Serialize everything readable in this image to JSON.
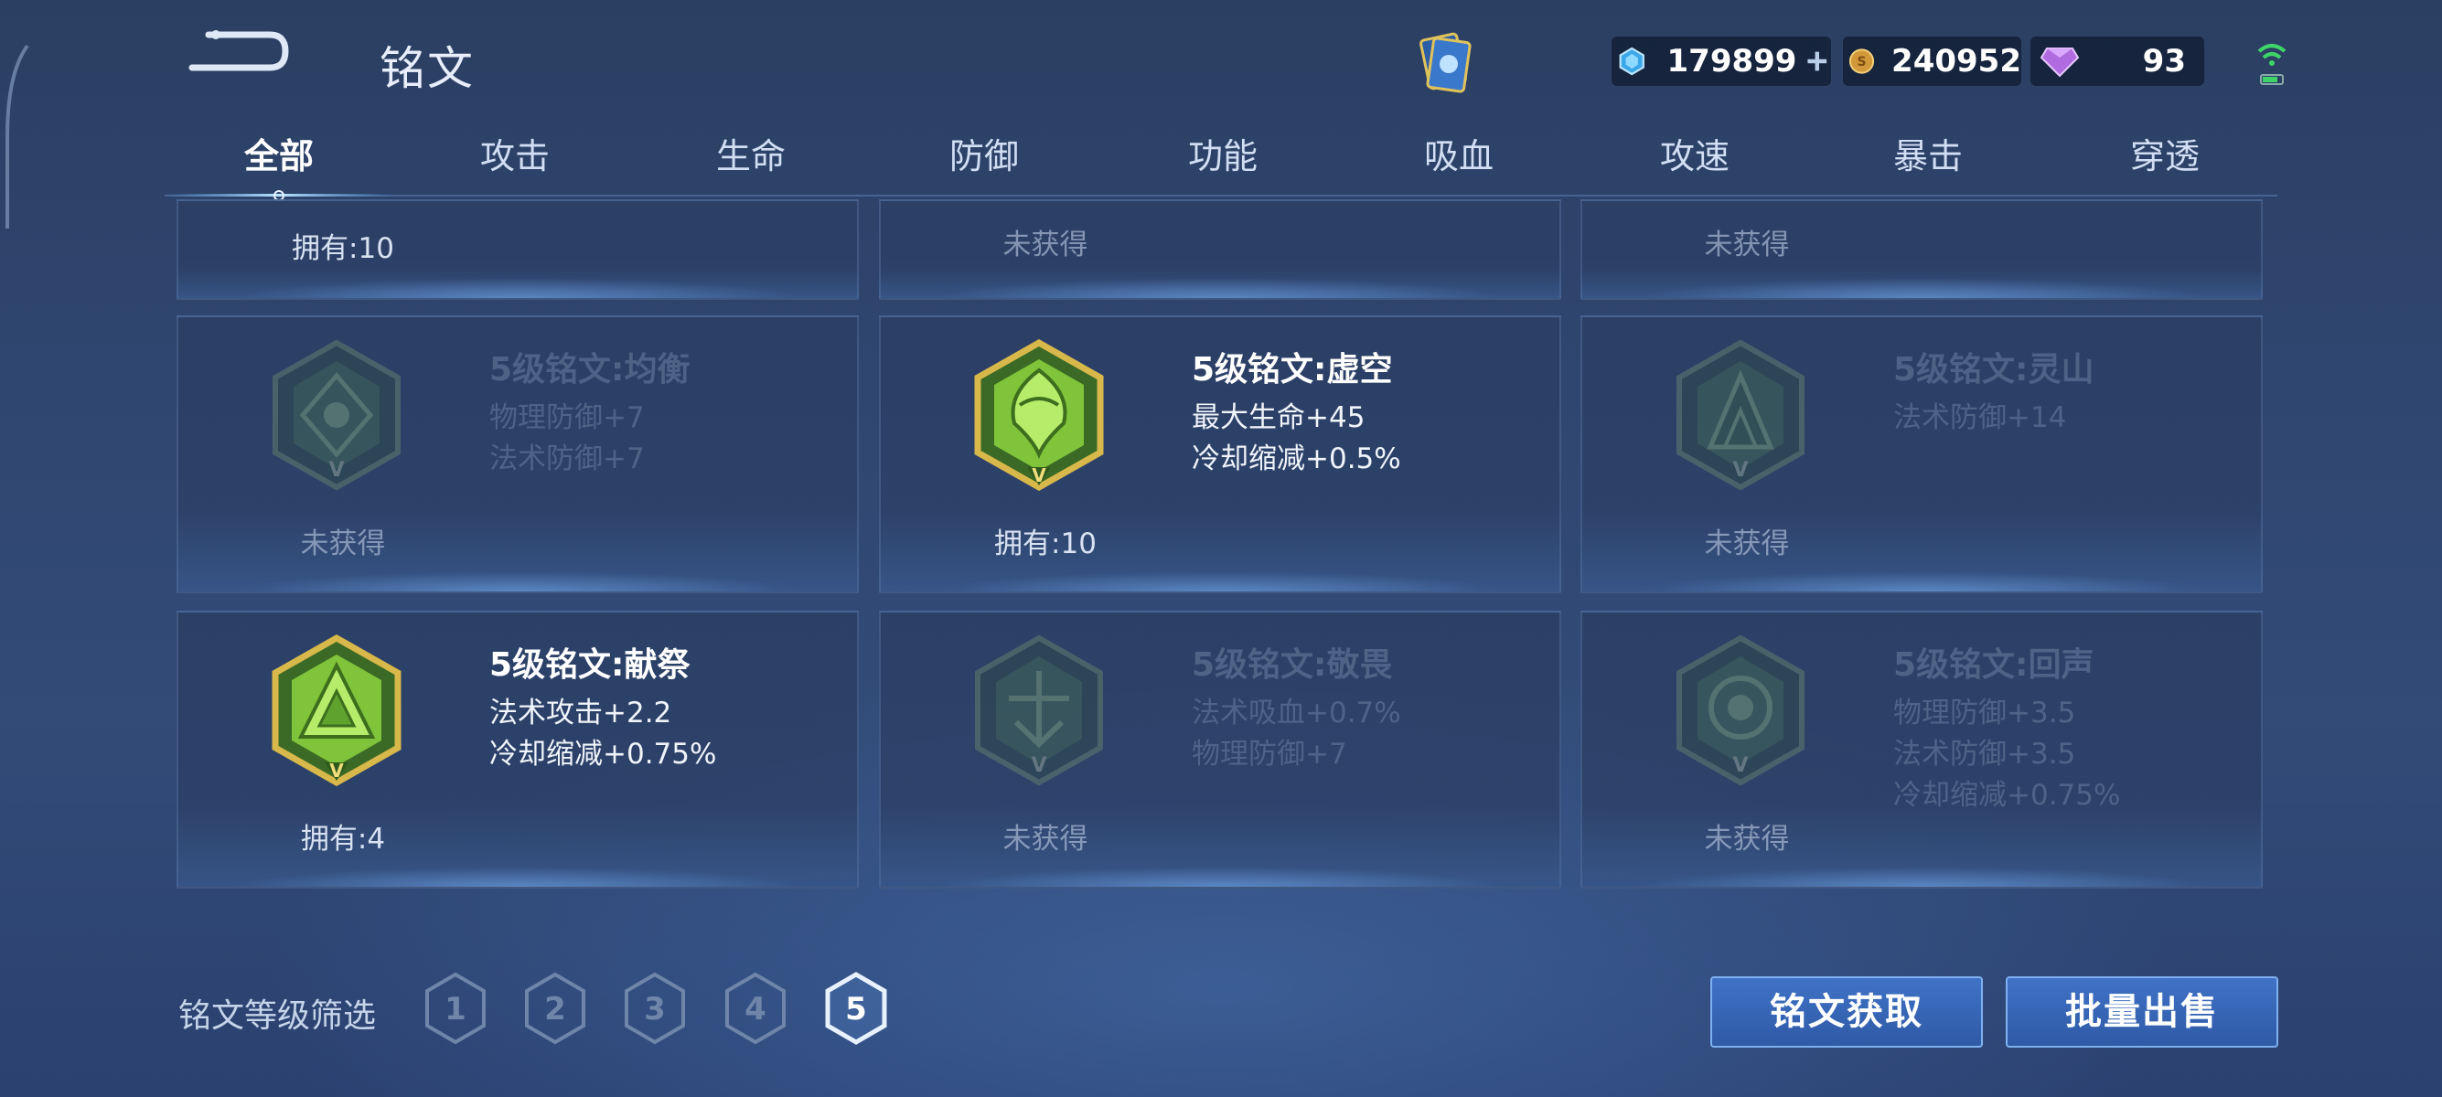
{
  "header": {
    "title": "铭文",
    "currencies": [
      {
        "name": "diamond",
        "value": "179899",
        "icon": "diamond-icon"
      },
      {
        "name": "gold",
        "value": "240952",
        "icon": "gold-coin-icon"
      },
      {
        "name": "gem",
        "value": "93",
        "icon": "purple-gem-icon"
      }
    ]
  },
  "tabs": [
    "全部",
    "攻击",
    "生命",
    "防御",
    "功能",
    "吸血",
    "攻速",
    "暴击",
    "穿透"
  ],
  "active_tab": "全部",
  "top_row": [
    {
      "count_text": "拥有:10"
    },
    {
      "count_text": "未获得"
    },
    {
      "count_text": "未获得"
    }
  ],
  "cards": [
    {
      "name": "5级铭文:均衡",
      "stats": [
        "物理防御+7",
        "法术防御+7"
      ],
      "count_text": "未获得",
      "owned": false
    },
    {
      "name": "5级铭文:虚空",
      "stats": [
        "最大生命+45",
        "冷却缩减+0.5%"
      ],
      "count_text": "拥有:10",
      "owned": true
    },
    {
      "name": "5级铭文:灵山",
      "stats": [
        "法术防御+14"
      ],
      "count_text": "未获得",
      "owned": false
    },
    {
      "name": "5级铭文:献祭",
      "stats": [
        "法术攻击+2.2",
        "冷却缩减+0.75%"
      ],
      "count_text": "拥有:4",
      "owned": true
    },
    {
      "name": "5级铭文:敬畏",
      "stats": [
        "法术吸血+0.7%",
        "物理防御+7"
      ],
      "count_text": "未获得",
      "owned": false
    },
    {
      "name": "5级铭文:回声",
      "stats": [
        "物理防御+3.5",
        "法术防御+3.5",
        "冷却缩减+0.75%"
      ],
      "count_text": "未获得",
      "owned": false
    }
  ],
  "filter": {
    "label": "铭文等级筛选",
    "levels": [
      "1",
      "2",
      "3",
      "4",
      "5"
    ],
    "selected": "5"
  },
  "buttons": {
    "obtain": "铭文获取",
    "bulk_sell": "批量出售"
  },
  "colors": {
    "accent": "#3f72c6",
    "owned_gem": "#8fd13a",
    "gold_frame": "#c9a93a"
  }
}
